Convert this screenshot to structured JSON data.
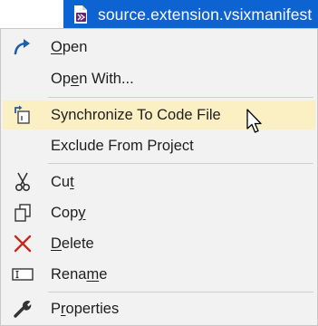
{
  "title_tab": {
    "label": "source.extension.vsixmanifest",
    "icon": "vsix-manifest-icon"
  },
  "menu": {
    "items": [
      {
        "name": "open",
        "pre": "",
        "key": "O",
        "post": "pen",
        "icon": "open-arrow-icon"
      },
      {
        "name": "open-with",
        "pre": "Op",
        "key": "e",
        "post": "n With...",
        "icon": ""
      },
      {
        "name": "synchronize",
        "pre": "Synchronize To Code File",
        "key": "",
        "post": "",
        "icon": "synchronize-icon",
        "highlighted": true
      },
      {
        "name": "exclude",
        "pre": "Exclude From Project",
        "key": "",
        "post": "",
        "icon": ""
      },
      {
        "name": "cut",
        "pre": "Cu",
        "key": "t",
        "post": "",
        "icon": "scissors-icon"
      },
      {
        "name": "copy",
        "pre": "Cop",
        "key": "y",
        "post": "",
        "icon": "copy-icon"
      },
      {
        "name": "delete",
        "pre": "",
        "key": "D",
        "post": "elete",
        "icon": "delete-x-icon"
      },
      {
        "name": "rename",
        "pre": "Rena",
        "key": "m",
        "post": "e",
        "icon": "rename-icon"
      },
      {
        "name": "properties",
        "pre": "P",
        "key": "r",
        "post": "operties",
        "icon": "wrench-icon"
      }
    ]
  },
  "colors": {
    "title_bg": "#0e63d2",
    "menu_bg": "#f2f2f2",
    "hover_bg": "#fbf0c4",
    "icon_blue": "#1e5fa8",
    "delete_red": "#c42b1c"
  }
}
